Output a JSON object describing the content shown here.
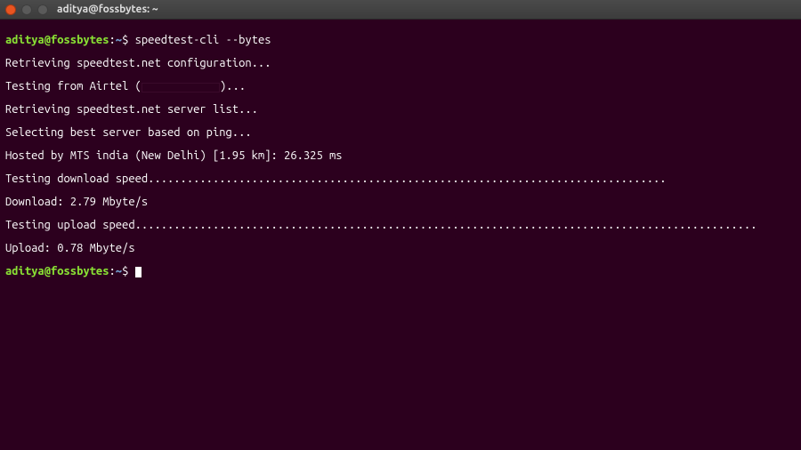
{
  "window": {
    "title": "aditya@fossbytes: ~"
  },
  "prompt": {
    "user": "aditya",
    "at": "@",
    "host": "fossbytes",
    "colon": ":",
    "path": "~",
    "dollar": "$"
  },
  "command1": "speedtest-cli --bytes",
  "output": {
    "l1": "Retrieving speedtest.net configuration...",
    "l2a": "Testing from Airtel (",
    "l2b": ")...",
    "l3": "Retrieving speedtest.net server list...",
    "l4": "Selecting best server based on ping...",
    "l5": "Hosted by MTS india (New Delhi) [1.95 km]: 26.325 ms",
    "l6": "Testing download speed................................................................................",
    "l7": "Download: 2.79 Mbyte/s",
    "l8": "Testing upload speed................................................................................................",
    "l9": "Upload: 0.78 Mbyte/s"
  }
}
